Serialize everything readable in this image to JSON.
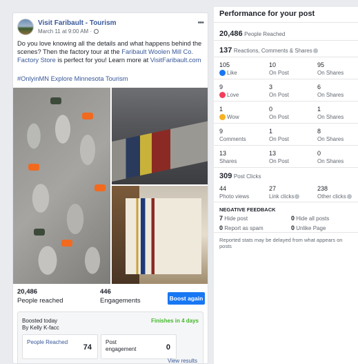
{
  "post": {
    "page_name": "Visit Faribault - Tourism",
    "time": "March 11 at 9:00 AM",
    "text_part1": "Do you love knowing all the details and what happens behind the scenes? Then the factory tour at the ",
    "link1": "Faribault Woolen Mill Co. Factory Store",
    "text_part2": " is perfect for you! Learn more at ",
    "link2": "VisitFaribault.com",
    "hashtags": "#OnlyinMN Explore Minnesota Tourism",
    "people_reached_num": "20,486",
    "people_reached_label": "People reached",
    "engagements_num": "446",
    "engagements_label": "Engagements",
    "boost_again": "Boost again",
    "boosted_title": "Boosted today",
    "boosted_by": "By Kelly K-facc",
    "finishes": "Finishes in 4 days",
    "metric1_label": "People Reached",
    "metric1_value": "74",
    "metric2_label": "Post engagement",
    "metric2_value": "0",
    "view_results": "View results"
  },
  "panel": {
    "title": "Performance for your post",
    "reached_num": "20,486",
    "reached_label": "People Reached",
    "reactions_num": "137",
    "reactions_label": "Reactions, Comments & Shares",
    "rows": [
      {
        "a_num": "105",
        "a_label": "Like",
        "b_num": "10",
        "b_label": "On Post",
        "c_num": "95",
        "c_label": "On Shares"
      },
      {
        "a_num": "9",
        "a_label": "Love",
        "b_num": "3",
        "b_label": "On Post",
        "c_num": "6",
        "c_label": "On Shares"
      },
      {
        "a_num": "1",
        "a_label": "Wow",
        "b_num": "0",
        "b_label": "On Post",
        "c_num": "1",
        "c_label": "On Shares"
      },
      {
        "a_num": "9",
        "a_label": "Comments",
        "b_num": "1",
        "b_label": "On Post",
        "c_num": "8",
        "c_label": "On Shares"
      },
      {
        "a_num": "13",
        "a_label": "Shares",
        "b_num": "13",
        "b_label": "On Post",
        "c_num": "0",
        "c_label": "On Shares"
      }
    ],
    "clicks_num": "309",
    "clicks_label": "Post Clicks",
    "photo_views_num": "44",
    "photo_views_label": "Photo views",
    "link_clicks_num": "27",
    "link_clicks_label": "Link clicks",
    "other_clicks_num": "238",
    "other_clicks_label": "Other clicks",
    "neg_title": "NEGATIVE FEEDBACK",
    "hide_post_num": "7",
    "hide_post_label": "Hide post",
    "hide_all_num": "0",
    "hide_all_label": "Hide all posts",
    "report_num": "0",
    "report_label": "Report as spam",
    "unlike_num": "0",
    "unlike_label": "Unlike Page",
    "footnote": "Reported stats may be delayed from what appears on posts"
  },
  "colors": {
    "accent": "#1877f2",
    "link": "#385898",
    "success": "#42b72a"
  }
}
